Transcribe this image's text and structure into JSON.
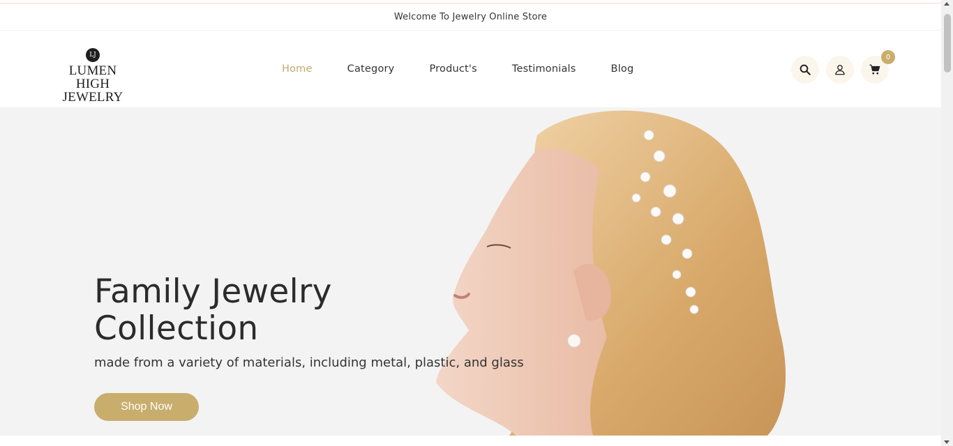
{
  "announcement": "Welcome To Jewelry Online Store",
  "logo": {
    "badge": "LJ",
    "line1": "LUMEN HIGH",
    "line2": "JEWELRY"
  },
  "nav": [
    {
      "label": "Home",
      "active": true
    },
    {
      "label": "Category"
    },
    {
      "label": "Product's"
    },
    {
      "label": "Testimonials"
    },
    {
      "label": "Blog"
    }
  ],
  "header_icons": {
    "search": "search-icon",
    "account": "user-icon",
    "cart": "cart-icon",
    "cart_count": "0"
  },
  "hero": {
    "title_line1": "Family Jewelry",
    "title_line2": "Collection",
    "subtitle": "made from a variety of materials, including metal, plastic, and glass",
    "button": "Shop Now"
  },
  "colors": {
    "accent": "#c8ad6c",
    "hero_bg": "#f3f3f3",
    "icon_bg": "#fbf6ec"
  }
}
